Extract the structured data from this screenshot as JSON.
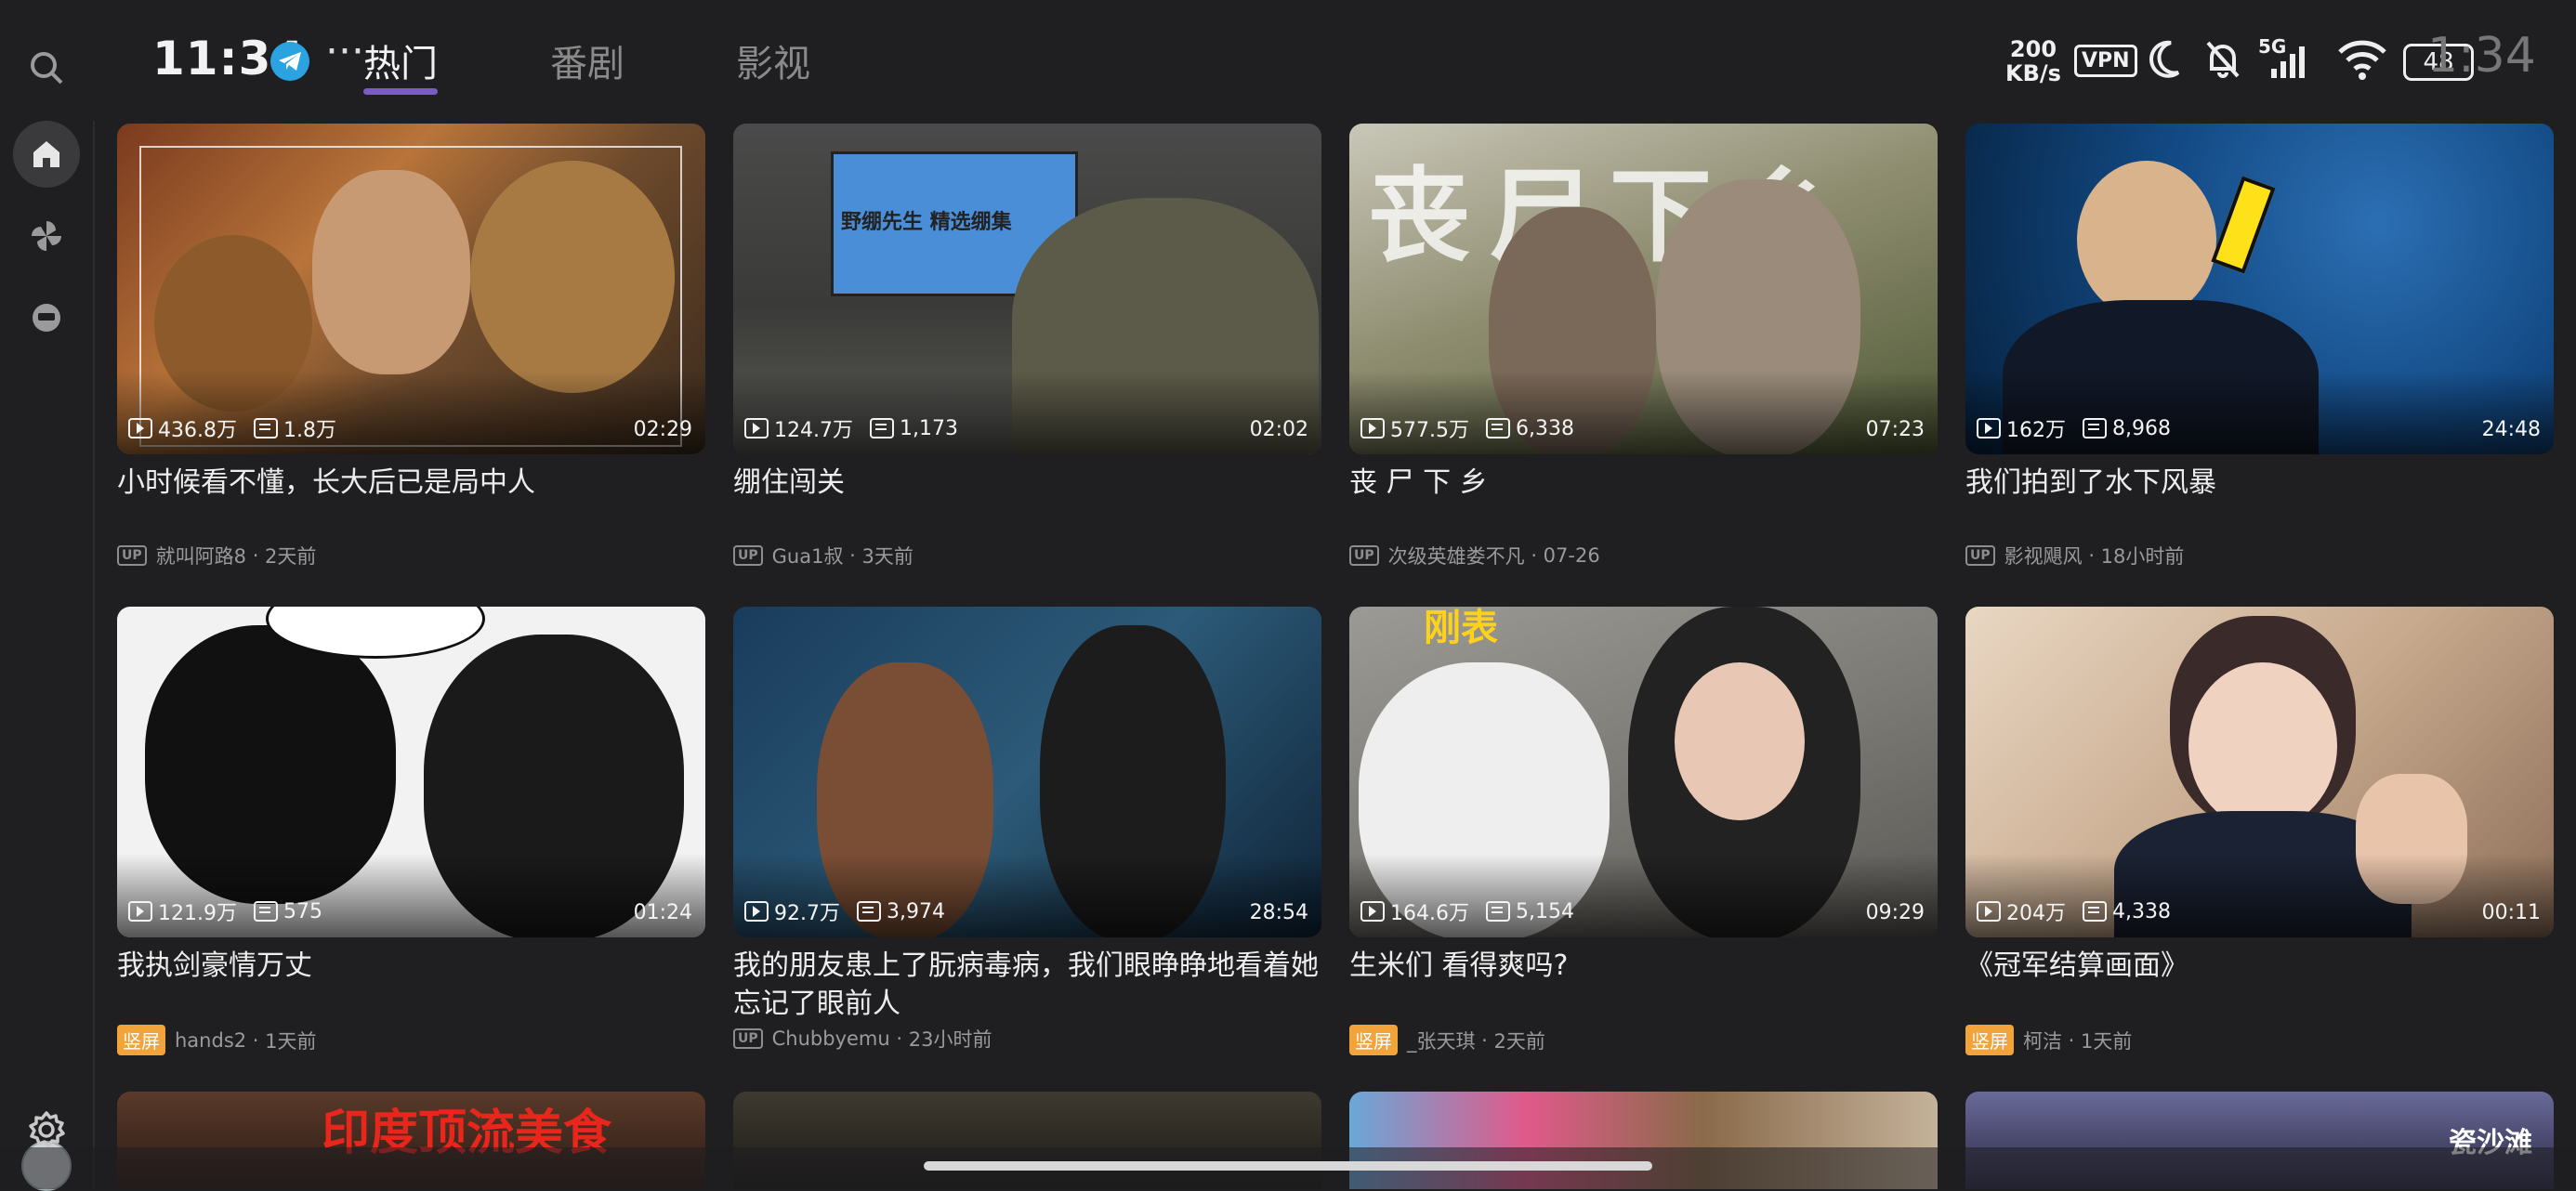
{
  "status_bar": {
    "time": "11:34",
    "speed_value": "200",
    "speed_unit": "KB/s",
    "vpn": "VPN",
    "signal_label": "5G",
    "battery": "48",
    "ghost_time": "1:34"
  },
  "nav": {
    "more": "···",
    "tabs": [
      {
        "label": "热门",
        "active": true
      },
      {
        "label": "番剧",
        "active": false
      },
      {
        "label": "影视",
        "active": false
      }
    ]
  },
  "sidebar": {
    "items": [
      {
        "icon": "search-icon"
      },
      {
        "icon": "home-icon",
        "active": true
      },
      {
        "icon": "pinwheel-icon"
      },
      {
        "icon": "bilibili-tv-icon"
      },
      {
        "icon": "avatar"
      },
      {
        "icon": "gear-icon"
      }
    ]
  },
  "videos": [
    {
      "title": "小时候看不懂，长大后已是局中人",
      "views": "436.8万",
      "danmaku": "1.8万",
      "duration": "02:29",
      "badge": "UP",
      "author": "就叫阿路8",
      "time": "2天前"
    },
    {
      "title": "绷住闯关",
      "views": "124.7万",
      "danmaku": "1,173",
      "duration": "02:02",
      "badge": "UP",
      "author": "Gua1叔",
      "time": "3天前"
    },
    {
      "title": "丧 尸 下 乡",
      "views": "577.5万",
      "danmaku": "6,338",
      "duration": "07:23",
      "badge": "UP",
      "author": "次级英雄娄不凡",
      "time": "07-26"
    },
    {
      "title": "我们拍到了水下风暴",
      "views": "162万",
      "danmaku": "8,968",
      "duration": "24:48",
      "badge": "UP",
      "author": "影视飓风",
      "time": "18小时前"
    },
    {
      "title": "我执剑豪情万丈",
      "views": "121.9万",
      "danmaku": "575",
      "duration": "01:24",
      "badge": "竖屏",
      "author": "hands2",
      "time": "1天前"
    },
    {
      "title": "我的朋友患上了朊病毒病，我们眼睁睁地看着她忘记了眼前人",
      "views": "92.7万",
      "danmaku": "3,974",
      "duration": "28:54",
      "badge": "UP",
      "author": "Chubbyemu",
      "time": "23小时前"
    },
    {
      "title": "生米们 看得爽吗?",
      "views": "164.6万",
      "danmaku": "5,154",
      "duration": "09:29",
      "badge": "竖屏",
      "author": "_张天琪",
      "time": "2天前"
    },
    {
      "title": "《冠军结算画面》",
      "views": "204万",
      "danmaku": "4,338",
      "duration": "00:11",
      "badge": "竖屏",
      "author": "柯洁",
      "time": "1天前"
    }
  ],
  "thumbnail_texts": {
    "v2": "野绷先生 精选绷集",
    "v3": "丧尸下乡",
    "v7": "刚表",
    "r3a": "印度顶流美食",
    "r3d": "瓷沙滩"
  },
  "colors": {
    "background": "#1f1f21",
    "accent_underline": "#7a5cc2",
    "vertical_badge": "#f2a33a"
  }
}
